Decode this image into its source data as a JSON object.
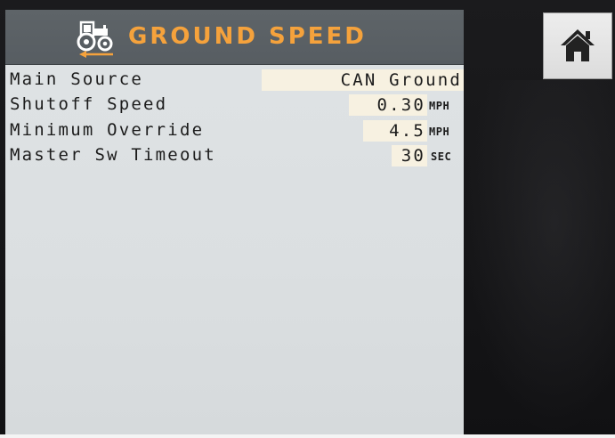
{
  "header": {
    "title": "GROUND SPEED",
    "icon": "tractor-speed-icon",
    "accent_color": "#f5a23c"
  },
  "settings": [
    {
      "label": "Main Source",
      "value": "CAN Ground",
      "unit": ""
    },
    {
      "label": "Shutoff Speed",
      "value": "0.30",
      "unit": "MPH"
    },
    {
      "label": "Minimum Override",
      "value": "4.5",
      "unit": "MPH"
    },
    {
      "label": "Master Sw Timeout",
      "value": "30",
      "unit": "SEC"
    }
  ],
  "nav": {
    "home_icon": "home-icon"
  },
  "colors": {
    "title_bar": "#5b6165",
    "screen_bg": "#dcdfe1",
    "value_bg": "#f7f1e1"
  }
}
